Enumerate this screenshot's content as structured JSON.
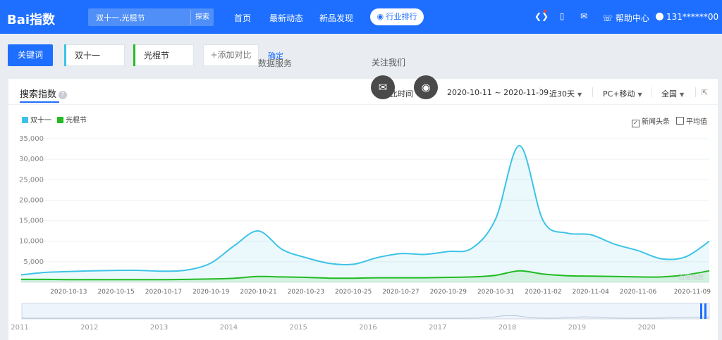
{
  "header": {
    "logo_text": "Bai指数",
    "logo_mark": "du",
    "search_query": "双十一,光棍节",
    "search_button": "探索",
    "nav": [
      "首页",
      "最新动态",
      "新品发现"
    ],
    "rank_button": "行业排行",
    "help_label": "帮助中心",
    "user_label": "131******00"
  },
  "keywords": {
    "label": "关键词",
    "terms": [
      "双十一",
      "光棍节"
    ],
    "add_label": "+添加对比",
    "confirm_label": "确定"
  },
  "ghost": {
    "data_service": "数据服务",
    "follow_us": "关注我们",
    "compare_time": "对比时间"
  },
  "panel": {
    "tab_label": "搜索指数",
    "date_range": "2020-10-11 ~ 2020-11-09",
    "period": "近30天",
    "device": "PC+移动",
    "region": "全国",
    "options": [
      {
        "label": "新闻头条",
        "checked": true
      },
      {
        "label": "平均值",
        "checked": false
      }
    ],
    "watermark": "百度指数"
  },
  "colors": {
    "accent": "#1e6fff",
    "series1": "#3ec3e6",
    "series2": "#22bb22"
  },
  "chart_data": {
    "type": "area",
    "title": "",
    "xlabel": "",
    "ylabel": "",
    "ylim": [
      0,
      35000
    ],
    "yticks": [
      "5,000",
      "10,000",
      "15,000",
      "20,000",
      "25,000",
      "30,000",
      "35,000"
    ],
    "grid": true,
    "legend": "top-left",
    "x": [
      "2020-10-11",
      "2020-10-12",
      "2020-10-13",
      "2020-10-14",
      "2020-10-15",
      "2020-10-16",
      "2020-10-17",
      "2020-10-18",
      "2020-10-19",
      "2020-10-20",
      "2020-10-21",
      "2020-10-22",
      "2020-10-23",
      "2020-10-24",
      "2020-10-25",
      "2020-10-26",
      "2020-10-27",
      "2020-10-28",
      "2020-10-29",
      "2020-10-30",
      "2020-10-31",
      "2020-11-01",
      "2020-11-02",
      "2020-11-03",
      "2020-11-04",
      "2020-11-05",
      "2020-11-06",
      "2020-11-07",
      "2020-11-08",
      "2020-11-09"
    ],
    "xticks": [
      "2020-10-13",
      "2020-10-15",
      "2020-10-17",
      "2020-10-19",
      "2020-10-21",
      "2020-10-23",
      "2020-10-25",
      "2020-10-27",
      "2020-10-29",
      "2020-10-31",
      "2020-11-02",
      "2020-11-04",
      "2020-11-06",
      "2020-11-09"
    ],
    "series": [
      {
        "name": "双十一",
        "values": [
          1800,
          2400,
          2600,
          2800,
          2900,
          2900,
          2700,
          3000,
          4700,
          9000,
          12500,
          8000,
          6000,
          4600,
          4400,
          6000,
          7000,
          6800,
          7500,
          8300,
          15500,
          33300,
          15000,
          12000,
          11600,
          9300,
          7700,
          5700,
          6200,
          10000
        ]
      },
      {
        "name": "光棍节",
        "values": [
          700,
          700,
          650,
          650,
          650,
          650,
          650,
          700,
          800,
          1000,
          1400,
          1300,
          1200,
          1000,
          1000,
          1100,
          1100,
          1100,
          1200,
          1300,
          1700,
          2800,
          2000,
          1600,
          1500,
          1400,
          1300,
          1300,
          1800,
          2800
        ]
      }
    ]
  },
  "timeline": {
    "years": [
      "2011",
      "2012",
      "2013",
      "2014",
      "2015",
      "2016",
      "2017",
      "2018",
      "2019",
      "2020"
    ]
  }
}
